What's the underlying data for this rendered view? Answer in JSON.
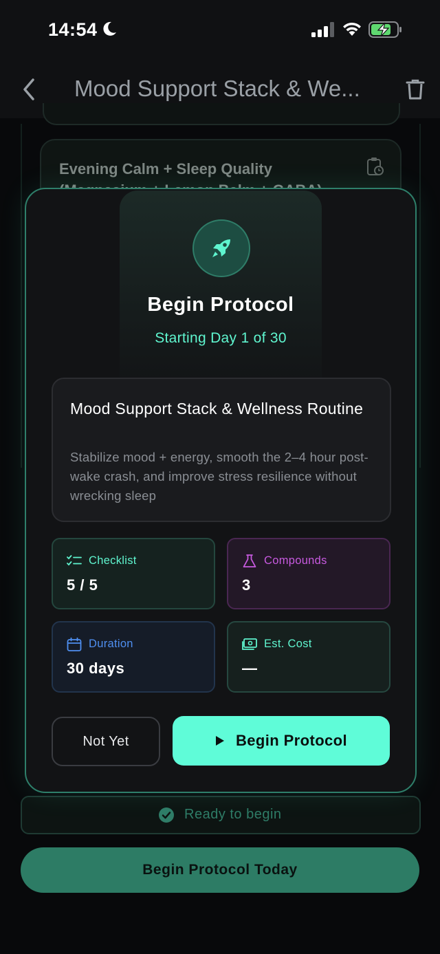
{
  "status_bar": {
    "time": "14:54"
  },
  "header": {
    "title": "Mood Support Stack & We..."
  },
  "background": {
    "card_title": "Evening Calm + Sleep Quality (Magnesium + Lemon Balm + GABA)",
    "ready_text": "Ready to begin",
    "begin_today_label": "Begin Protocol Today"
  },
  "modal": {
    "title": "Begin Protocol",
    "subtitle": "Starting Day 1 of 30",
    "protocol": {
      "name": "Mood Support Stack & Wellness Routine",
      "description": "Stabilize mood + energy, smooth the 2–4 hour post-wake crash, and improve stress resilience without wrecking sleep"
    },
    "stats": {
      "checklist": {
        "label": "Checklist",
        "value": "5 / 5"
      },
      "compounds": {
        "label": "Compounds",
        "value": "3"
      },
      "duration": {
        "label": "Duration",
        "value": "30 days"
      },
      "cost": {
        "label": "Est. Cost",
        "value": "—"
      }
    },
    "buttons": {
      "not_yet": "Not Yet",
      "begin": "Begin Protocol"
    }
  },
  "colors": {
    "accent": "#5ffcd8",
    "checklist": "#5ff5cf",
    "compounds": "#c85ae0",
    "duration": "#4f8ff0",
    "cost": "#5ff5cf",
    "background": "#08090b"
  }
}
